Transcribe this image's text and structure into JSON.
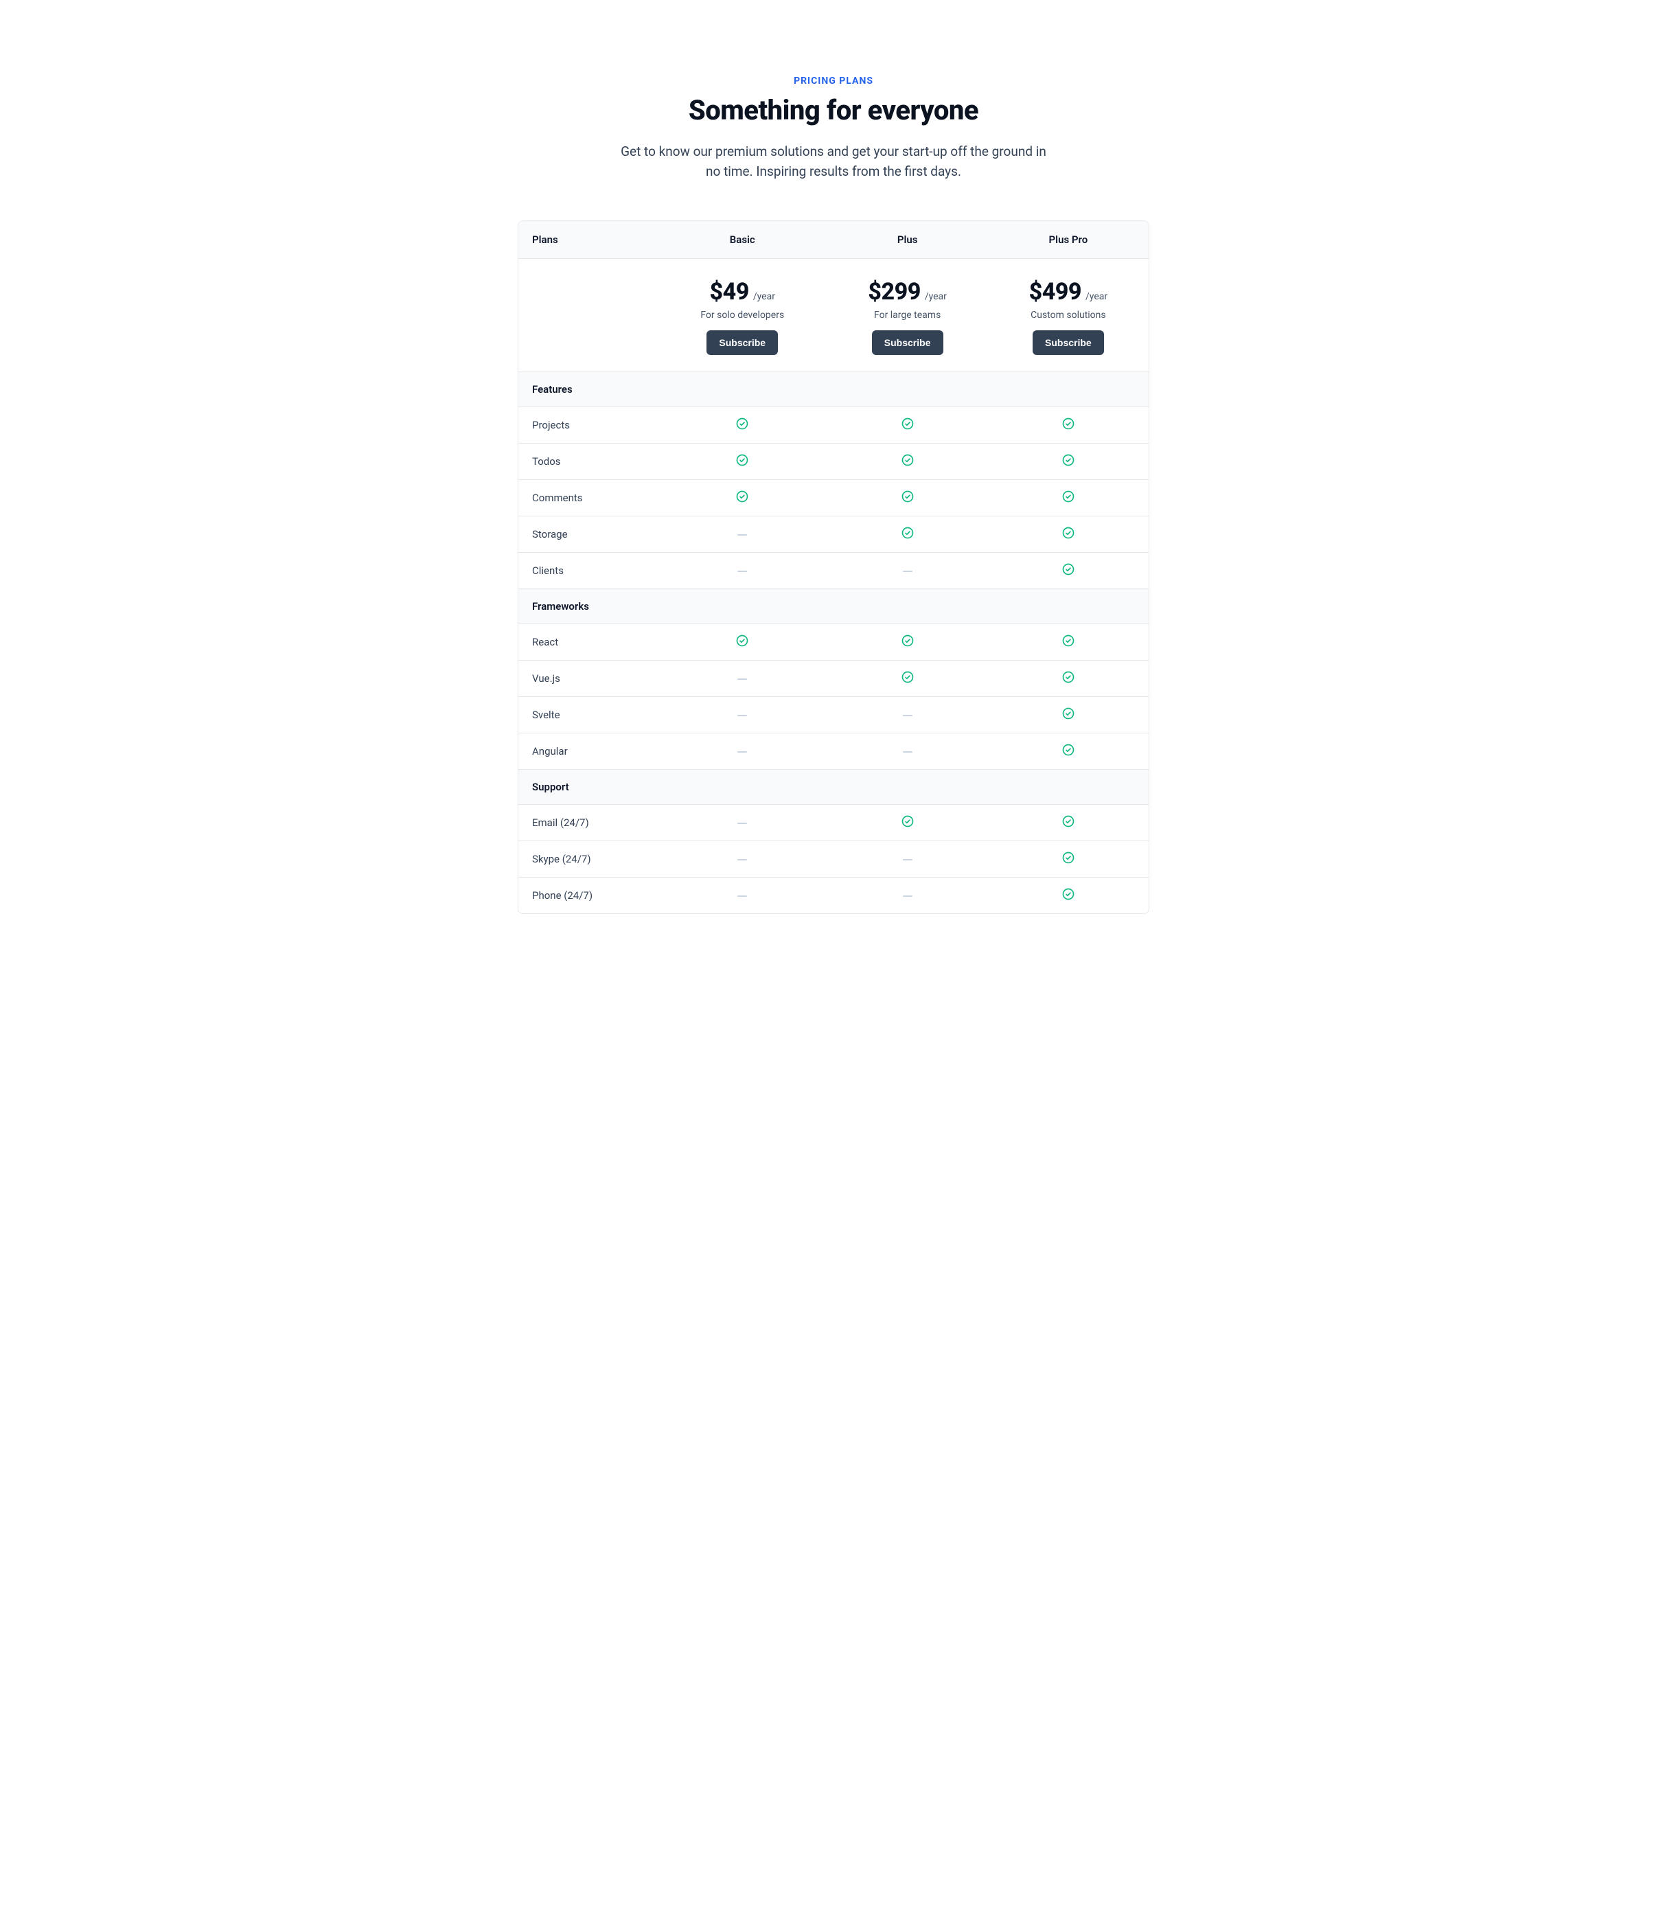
{
  "header": {
    "eyebrow": "PRICING PLANS",
    "headline": "Something for everyone",
    "subhead": "Get to know our premium solutions and get your start-up off the ground in no time. Inspiring results from the first days."
  },
  "table": {
    "plans_label": "Plans",
    "period_label": "/year",
    "subscribe_label": "Subscribe",
    "plans": [
      {
        "name": "Basic",
        "price": "$49",
        "desc": "For solo developers"
      },
      {
        "name": "Plus",
        "price": "$299",
        "desc": "For large teams"
      },
      {
        "name": "Plus Pro",
        "price": "$499",
        "desc": "Custom solutions"
      }
    ],
    "sections": [
      {
        "title": "Features",
        "rows": [
          {
            "label": "Projects",
            "values": [
              true,
              true,
              true
            ]
          },
          {
            "label": "Todos",
            "values": [
              true,
              true,
              true
            ]
          },
          {
            "label": "Comments",
            "values": [
              true,
              true,
              true
            ]
          },
          {
            "label": "Storage",
            "values": [
              false,
              true,
              true
            ]
          },
          {
            "label": "Clients",
            "values": [
              false,
              false,
              true
            ]
          }
        ]
      },
      {
        "title": "Frameworks",
        "rows": [
          {
            "label": "React",
            "values": [
              true,
              true,
              true
            ]
          },
          {
            "label": "Vue.js",
            "values": [
              false,
              true,
              true
            ]
          },
          {
            "label": "Svelte",
            "values": [
              false,
              false,
              true
            ]
          },
          {
            "label": "Angular",
            "values": [
              false,
              false,
              true
            ]
          }
        ]
      },
      {
        "title": "Support",
        "rows": [
          {
            "label": "Email (24/7)",
            "values": [
              false,
              true,
              true
            ]
          },
          {
            "label": "Skype (24/7)",
            "values": [
              false,
              false,
              true
            ]
          },
          {
            "label": "Phone (24/7)",
            "values": [
              false,
              false,
              true
            ]
          }
        ]
      }
    ]
  }
}
